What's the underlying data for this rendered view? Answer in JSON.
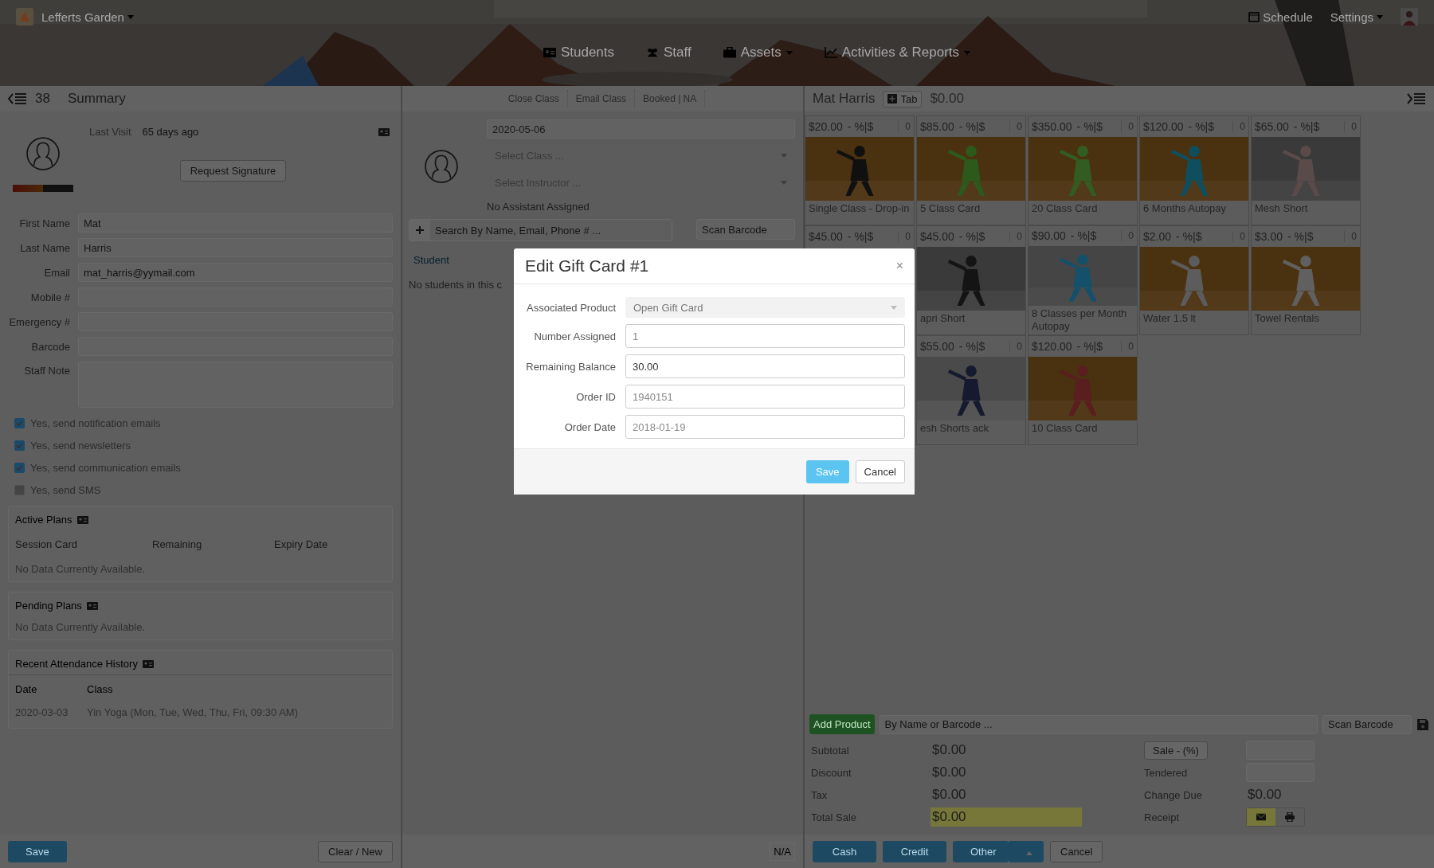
{
  "brand": {
    "name": "Lefferts Garden"
  },
  "nav": [
    {
      "label": "Students",
      "dropdown": false
    },
    {
      "label": "Staff",
      "dropdown": false
    },
    {
      "label": "Assets",
      "dropdown": true
    },
    {
      "label": "Activities & Reports",
      "dropdown": true
    }
  ],
  "top_right": {
    "schedule": "Schedule",
    "settings": "Settings"
  },
  "left": {
    "count": "38",
    "title": "Summary",
    "last_visit_label": "Last Visit",
    "last_visit": "65 days ago",
    "request_signature": "Request Signature",
    "fields": [
      {
        "label": "First Name",
        "kind": "input",
        "placeholder": "Mat"
      },
      {
        "label": "Last Name",
        "kind": "input",
        "placeholder": "Harris"
      },
      {
        "label": "Email",
        "kind": "input",
        "value": "mat_harris@yymail.com"
      },
      {
        "label": "Mobile #",
        "kind": "input"
      },
      {
        "label": "Emergency #",
        "kind": "input"
      },
      {
        "label": "Barcode",
        "kind": "input"
      },
      {
        "label": "Staff Note",
        "kind": "textarea"
      }
    ],
    "options": [
      {
        "label": "Yes, send notification emails",
        "checked": true
      },
      {
        "label": "Yes, send newsletters",
        "checked": true
      },
      {
        "label": "Yes, send communication emails",
        "checked": true
      },
      {
        "label": "Yes, send SMS",
        "checked": false
      }
    ],
    "active_plans": {
      "title": "Active Plans",
      "columns": [
        "Session Card",
        "Remaining",
        "Expiry Date"
      ],
      "empty": "No Data Currently Available."
    },
    "pending_plans": {
      "title": "Pending Plans",
      "empty": "No Data Currently Available."
    },
    "attendance": {
      "title": "Recent Attendance History",
      "columns": [
        "Date",
        "Class"
      ],
      "rows": [
        [
          "2020-03-03",
          "Yin Yoga (Mon, Tue, Wed, Thu, Fri, 09:30 AM)"
        ]
      ]
    },
    "save": "Save",
    "clear": "Clear / New"
  },
  "middle": {
    "actions": [
      "Close Class",
      "Email Class",
      "Booked | NA"
    ],
    "date": "2020-05-06",
    "class_placeholder": "Select Class ...",
    "instructor_placeholder": "Select Instructor ...",
    "assistant": "No Assistant Assigned",
    "search_placeholder": "Search By Name, Email, Phone # ...",
    "scan_placeholder": "Scan Barcode",
    "student_header": "Student",
    "empty": "No students in this c",
    "footer": "N/A"
  },
  "right": {
    "customer": "Mat Harris",
    "tab": "Tab",
    "balance": "$0.00",
    "products": [
      {
        "kind": "full",
        "price": "$20.00",
        "discount": "- %|$",
        "qty": "0",
        "name": "Single Class - Drop-in"
      },
      {
        "kind": "full",
        "price": "$85.00",
        "discount": "- %|$",
        "qty": "0",
        "name": "5 Class Card"
      },
      {
        "kind": "full",
        "price": "$350.00",
        "discount": "- %|$",
        "qty": "0",
        "name": "20 Class Card"
      },
      {
        "kind": "full",
        "price": "$120.00",
        "discount": "- %|$",
        "qty": "0",
        "name": "6 Months Autopay"
      },
      {
        "kind": "full",
        "price": "$65.00",
        "discount": "- %|$",
        "qty": "0",
        "name": "Mesh Short"
      },
      {
        "kind": "partial",
        "price": "$45.00",
        "discount": "- %|$",
        "qty": "0"
      },
      {
        "kind": "full",
        "price": "$45.00",
        "discount": "- %|$",
        "qty": "0",
        "name": "apri Short"
      },
      {
        "kind": "full",
        "price": "$90.00",
        "discount": "- %|$",
        "qty": "0",
        "name": "8 Classes per Month Autopay"
      },
      {
        "kind": "full",
        "price": "$2.00",
        "discount": "- %|$",
        "qty": "0",
        "name": "Water 1.5 lt"
      },
      {
        "kind": "full",
        "price": "$3.00",
        "discount": "- %|$",
        "qty": "0",
        "name": "Towel Rentals"
      },
      {
        "kind": "full",
        "price": "$55.00",
        "discount": "- %|$",
        "qty": "0",
        "name": "esh Shorts ack"
      },
      {
        "kind": "full",
        "price": "$120.00",
        "discount": "- %|$",
        "qty": "0",
        "name": "10 Class Card"
      }
    ],
    "add_product": "Add Product",
    "product_search_placeholder": "By Name or Barcode ...",
    "scan_placeholder": "Scan Barcode",
    "totals": [
      {
        "label": "Subtotal",
        "value": "$0.00",
        "highlight": false
      },
      {
        "label": "Discount",
        "value": "$0.00",
        "highlight": false
      },
      {
        "label": "Tax",
        "value": "$0.00",
        "highlight": false
      },
      {
        "label": "Total Sale",
        "value": "$0.00",
        "highlight": true
      }
    ],
    "sale_button": "Sale - (%)",
    "tendered": "Tendered",
    "change_due_label": "Change Due",
    "change_due": "$0.00",
    "receipt": "Receipt",
    "payments": [
      {
        "label": "Cash",
        "kind": "plain"
      },
      {
        "label": "Credit",
        "kind": "plain"
      },
      {
        "label": "Other",
        "kind": "split"
      }
    ],
    "cancel": "Cancel"
  },
  "modal": {
    "title": "Edit Gift Card #1",
    "close": "×",
    "fields": [
      {
        "label": "Associated Product",
        "kind": "select",
        "value": "Open Gift Card"
      },
      {
        "label": "Number Assigned",
        "kind": "input",
        "placeholder": "1"
      },
      {
        "label": "Remaining Balance",
        "kind": "input",
        "value": "30.00"
      },
      {
        "label": "Order ID",
        "kind": "input",
        "placeholder": "1940151"
      },
      {
        "label": "Order Date",
        "kind": "input",
        "placeholder": "2018-01-19"
      }
    ],
    "save": "Save",
    "cancel": "Cancel"
  }
}
